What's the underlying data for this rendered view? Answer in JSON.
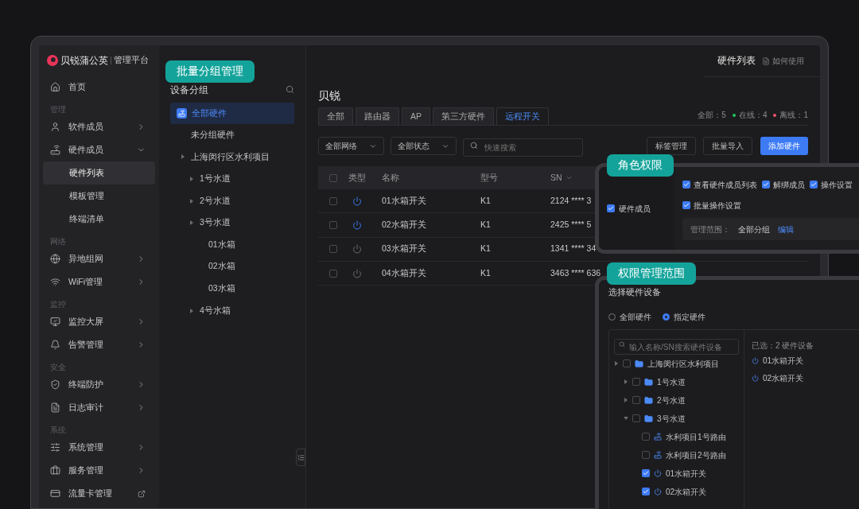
{
  "brand": {
    "name": "贝锐蒲公英",
    "subtitle": "管理平台"
  },
  "sidebar": [
    {
      "kind": "item",
      "label": "首页",
      "selected": false
    },
    {
      "kind": "section",
      "label": "管理"
    },
    {
      "kind": "group",
      "label": "软件成员",
      "expanded": false,
      "selected": false
    },
    {
      "kind": "group",
      "label": "硬件成员",
      "expanded": true,
      "selected": false
    },
    {
      "kind": "sub",
      "label": "硬件列表",
      "selected": true
    },
    {
      "kind": "sub",
      "label": "模板管理",
      "selected": false
    },
    {
      "kind": "sub",
      "label": "终端清单",
      "selected": false
    },
    {
      "kind": "section",
      "label": "网络"
    },
    {
      "kind": "group",
      "label": "异地组网",
      "expanded": false,
      "selected": false
    },
    {
      "kind": "group",
      "label": "WiFi管理",
      "expanded": false,
      "selected": false
    },
    {
      "kind": "section",
      "label": "监控"
    },
    {
      "kind": "group",
      "label": "监控大屏",
      "expanded": false,
      "selected": false
    },
    {
      "kind": "group",
      "label": "告警管理",
      "expanded": false,
      "selected": false
    },
    {
      "kind": "section",
      "label": "安全"
    },
    {
      "kind": "group",
      "label": "终端防护",
      "expanded": false,
      "selected": false
    },
    {
      "kind": "group",
      "label": "日志审计",
      "expanded": false,
      "selected": false
    },
    {
      "kind": "section",
      "label": "系统"
    },
    {
      "kind": "group",
      "label": "系统管理",
      "expanded": false,
      "selected": false
    },
    {
      "kind": "group",
      "label": "服务管理",
      "expanded": false,
      "selected": false
    },
    {
      "kind": "link",
      "label": "流量卡管理",
      "selected": false
    }
  ],
  "callouts": [
    "批量分组管理",
    "角色权限",
    "权限管理范围"
  ],
  "groups": {
    "title": "设备分组",
    "all": {
      "label": "全部硬件",
      "selected": true
    },
    "tree": [
      {
        "kind": "leaf",
        "label": "未分组硬件"
      },
      {
        "kind": "branch",
        "label": "上海闵行区水利项目",
        "children": [
          {
            "kind": "branch",
            "label": "1号水道"
          },
          {
            "kind": "branch",
            "label": "2号水道"
          },
          {
            "kind": "branch",
            "label": "3号水道",
            "children": [
              {
                "kind": "leaf",
                "label": "01水箱"
              },
              {
                "kind": "leaf",
                "label": "02水箱"
              },
              {
                "kind": "leaf",
                "label": "03水箱"
              }
            ]
          },
          {
            "kind": "branch",
            "label": "4号水箱"
          }
        ]
      }
    ]
  },
  "header": {
    "title": "硬件列表",
    "help": "如何使用"
  },
  "main": {
    "title": "贝锐",
    "tabs": [
      {
        "label": "全部",
        "selected": false
      },
      {
        "label": "路由器",
        "selected": false
      },
      {
        "label": "AP",
        "selected": false
      },
      {
        "label": "第三方硬件",
        "selected": false
      },
      {
        "label": "远程开关",
        "selected": true
      }
    ],
    "stats": [
      {
        "label": "全部：5"
      },
      {
        "label": "在线：4",
        "color": "#22c55e"
      },
      {
        "label": "离线：1",
        "color": "#f0506e"
      }
    ],
    "filters": [
      "全部网络",
      "全部状态"
    ],
    "search": {
      "placeholder": "快速搜索"
    },
    "buttons": [
      {
        "label": "标签管理",
        "kind": "default"
      },
      {
        "label": "批量导入",
        "kind": "default"
      },
      {
        "label": "添加硬件",
        "kind": "primary"
      }
    ],
    "table": {
      "all_checked": false,
      "columns": [
        "类型",
        "名称",
        "型号",
        "SN"
      ],
      "rows": [
        {
          "checked": false,
          "online": true,
          "name": "01水箱开关",
          "model": "K1",
          "sn": "2124 **** 3"
        },
        {
          "checked": false,
          "online": true,
          "name": "02水箱开关",
          "model": "K1",
          "sn": "2425 **** 5"
        },
        {
          "checked": false,
          "online": false,
          "name": "03水箱开关",
          "model": "K1",
          "sn": "1341 **** 34"
        },
        {
          "checked": false,
          "online": false,
          "name": "04水箱开关",
          "model": "K1",
          "sn": "3463 **** 636"
        }
      ]
    }
  },
  "role_card": {
    "member": {
      "label": "硬件成员",
      "checked": true
    },
    "permissions": [
      {
        "label": "查看硬件成员列表",
        "checked": true
      },
      {
        "label": "解绑成员",
        "checked": true
      },
      {
        "label": "操作设置",
        "checked": true
      },
      {
        "label": "批量操作设置",
        "checked": true
      }
    ],
    "scope_label": "管理范围：",
    "scope_value": "全部分组",
    "edit": "编辑"
  },
  "scope_card": {
    "title": "选择硬件设备",
    "radios": [
      {
        "label": "全部硬件",
        "selected": false
      },
      {
        "label": "指定硬件",
        "selected": true
      }
    ],
    "search": {
      "placeholder": "输入名称/SN搜索硬件设备"
    },
    "tree": [
      {
        "kind": "folder",
        "label": "上海闵行区水利项目",
        "checked": false,
        "expanded": false,
        "children": [
          {
            "kind": "folder",
            "label": "1号水道",
            "checked": false,
            "expanded": false
          },
          {
            "kind": "folder",
            "label": "2号水道",
            "checked": false,
            "expanded": false
          },
          {
            "kind": "folder",
            "label": "3号水道",
            "checked": false,
            "expanded": true,
            "children": [
              {
                "kind": "router",
                "label": "水利项目1号路由",
                "checked": false
              },
              {
                "kind": "router",
                "label": "水利项目2号路由",
                "checked": false
              },
              {
                "kind": "switch",
                "label": "01水箱开关",
                "checked": true
              },
              {
                "kind": "switch",
                "label": "02水箱开关",
                "checked": true
              }
            ]
          }
        ]
      }
    ],
    "selected_summary": "已选：2 硬件设备",
    "selected": [
      "01水箱开关",
      "02水箱开关"
    ]
  }
}
